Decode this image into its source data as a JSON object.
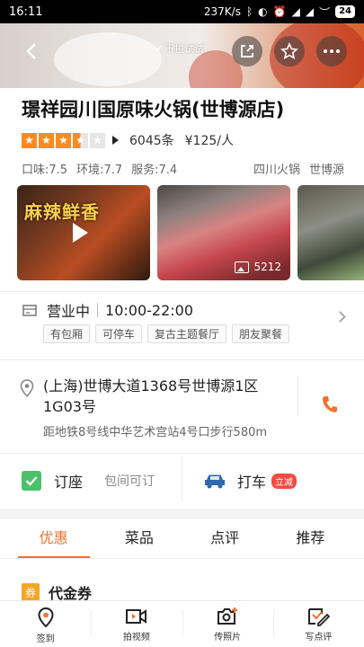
{
  "status_bar": {
    "time": "16:11",
    "speed": "237K/s",
    "battery": "24"
  },
  "hero": {
    "pull_hint": "下拉试试"
  },
  "restaurant": {
    "name": "璟祥园川国原味火锅(世博源店)",
    "rating_stars": 3.5,
    "review_count": "6045条",
    "price": "¥125/人",
    "scores": [
      "口味:7.5",
      "环境:7.7",
      "服务:7.4"
    ],
    "categories": [
      "四川火锅",
      "世博源"
    ]
  },
  "photos": {
    "video_caption": "麻辣鲜香",
    "photo_count": "5212"
  },
  "hours": {
    "status": "营业中",
    "time": "10:00-22:00"
  },
  "tags": [
    "有包厢",
    "可停车",
    "复古主题餐厅",
    "朋友聚餐"
  ],
  "address": {
    "line": "(上海)世博大道1368号世博源1区1G03号",
    "distance": "距地铁8号线中华艺术宫站4号口步行580m"
  },
  "actions": {
    "book_label": "订座",
    "book_sub": "包间可订",
    "taxi_label": "打车",
    "taxi_badge": "立减"
  },
  "tabs": [
    {
      "label": "优惠",
      "active": true
    },
    {
      "label": "菜品",
      "active": false
    },
    {
      "label": "点评",
      "active": false
    },
    {
      "label": "推荐",
      "active": false
    }
  ],
  "section": {
    "voucher_icon": "券",
    "voucher_title": "代金券"
  },
  "bottom_nav": [
    {
      "label": "签到",
      "icon": "location-pin-icon"
    },
    {
      "label": "拍视频",
      "icon": "video-camera-icon"
    },
    {
      "label": "传照片",
      "icon": "camera-plus-icon"
    },
    {
      "label": "写点评",
      "icon": "edit-review-icon"
    }
  ],
  "colors": {
    "accent": "#f2702d",
    "star": "#ff8a1f",
    "check": "#4bc26a",
    "badge": "#f24b41"
  }
}
